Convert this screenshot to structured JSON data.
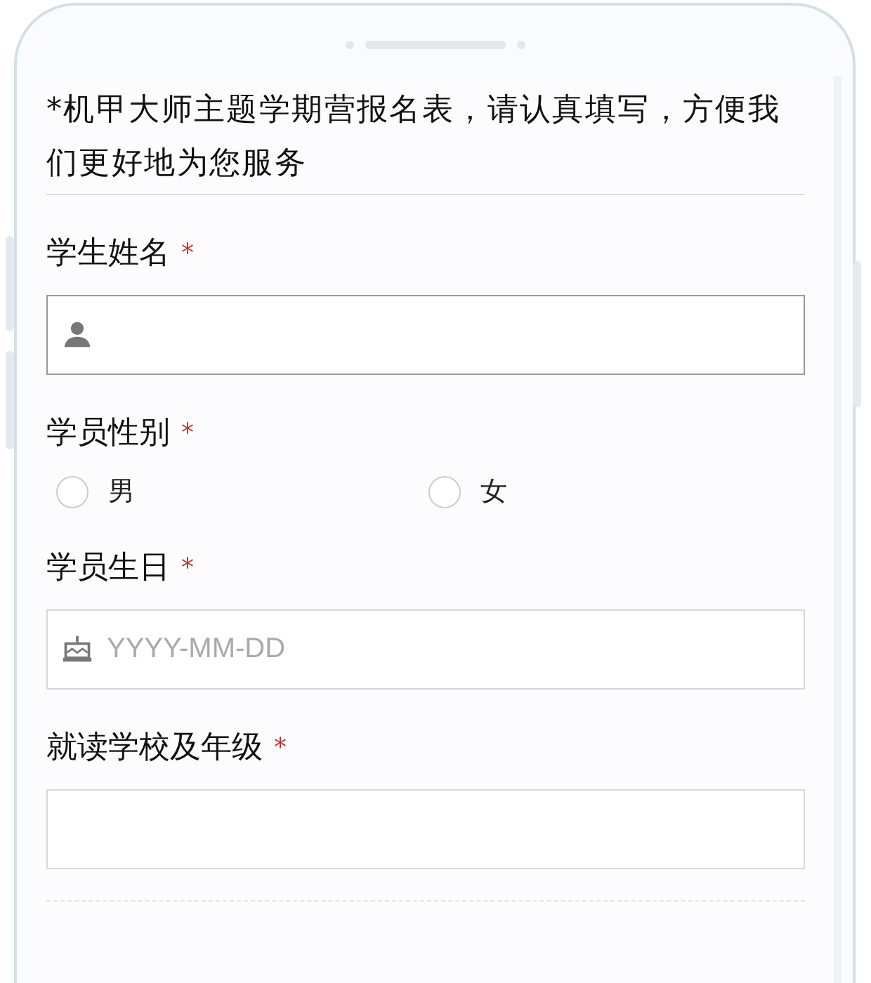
{
  "form": {
    "intro": "*机甲大师主题学期营报名表，请认真填写，方便我们更好地为您服务",
    "fields": [
      {
        "kind": "name",
        "label": "学生姓名",
        "required_mark": "*"
      },
      {
        "kind": "radio",
        "label": "学员性别",
        "required_mark": "*",
        "options": [
          {
            "label": "男",
            "selected": false
          },
          {
            "label": "女",
            "selected": false
          }
        ]
      },
      {
        "kind": "date",
        "label": "学员生日",
        "required_mark": "*",
        "placeholder": "YYYY-MM-DD"
      },
      {
        "kind": "text",
        "label": "就读学校及年级",
        "required_mark": "*"
      }
    ]
  }
}
